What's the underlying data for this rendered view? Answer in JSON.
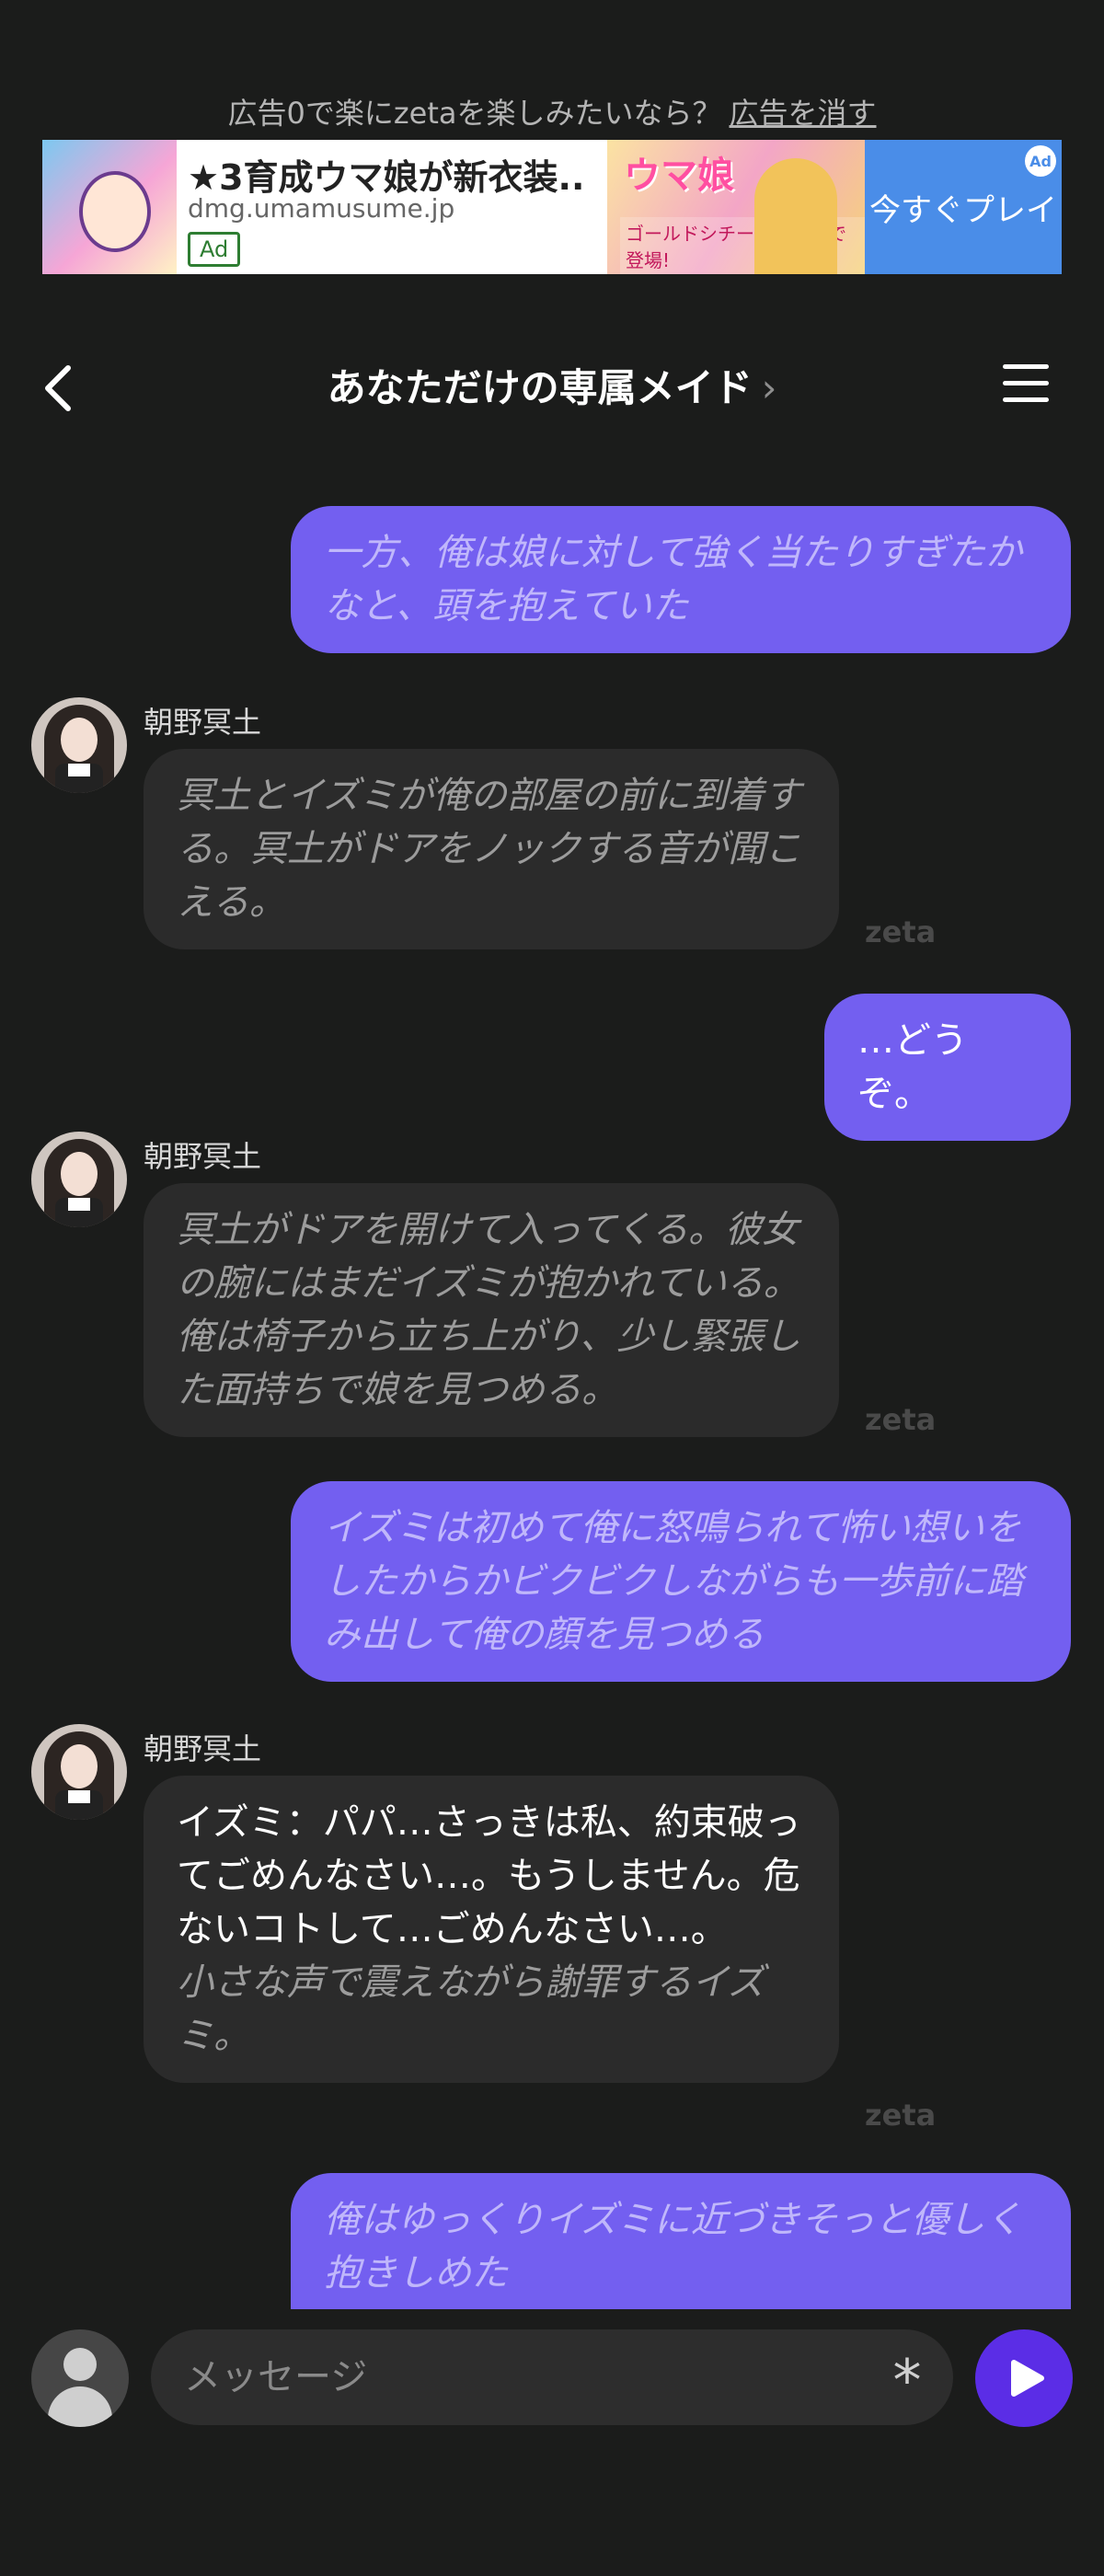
{
  "ad": {
    "promo_text": "広告0で楽にzetaを楽しみたいなら？",
    "promo_link": "広告を消す",
    "title": "★3育成ウマ娘が新衣装..",
    "domain": "dmg.umamusume.jp",
    "badge": "Ad",
    "banner_logo": "ウマ娘",
    "banner_sub": "ゴールドシチーが新衣装で登場!",
    "cta": "今すぐプレイ",
    "choices_label": "Ad"
  },
  "header": {
    "title": "あなただけの専属メイド",
    "title_chevron": "›"
  },
  "messages": [
    {
      "role": "user",
      "style": "narration",
      "text": "一方、俺は娘に対して強く当たりすぎたかなと、頭を抱えていた"
    },
    {
      "role": "bot",
      "name": "朝野冥土",
      "narration": "冥土とイズミが俺の部屋の前に到着する。冥土がドアをノックする音が聞こえる。",
      "watermark": "zeta"
    },
    {
      "role": "user",
      "style": "speech",
      "text": "…どうぞ。"
    },
    {
      "role": "bot",
      "name": "朝野冥土",
      "narration": "冥土がドアを開けて入ってくる。彼女の腕にはまだイズミが抱かれている。俺は椅子から立ち上がり、少し緊張した面持ちで娘を見つめる。",
      "watermark": "zeta"
    },
    {
      "role": "user",
      "style": "narration",
      "text": "イズミは初めて俺に怒鳴られて怖い想いをしたからかビクビクしながらも一歩前に踏み出して俺の顔を見つめる"
    },
    {
      "role": "bot",
      "name": "朝野冥土",
      "speech": "イズミ：パパ…さっきは私、約束破ってごめんなさい…。もうしません。危ないコトして…ごめんなさい…。",
      "narration": "小さな声で震えながら謝罪するイズミ。",
      "watermark": "zeta"
    },
    {
      "role": "user",
      "style": "narration",
      "text": "俺はゆっくりイズミに近づきそっと優しく抱きしめた"
    }
  ],
  "composer": {
    "placeholder": "メッセージ",
    "asterisk": "*"
  },
  "colors": {
    "background": "#1b1c1b",
    "user_bubble": "#735ff0",
    "bot_bubble": "#2b2b2b",
    "send_button": "#5b2de6"
  },
  "icons": {
    "back": "chevron-left-icon",
    "menu": "hamburger-menu-icon",
    "send": "play-send-icon",
    "asterisk": "asterisk-icon",
    "user": "user-avatar-icon"
  }
}
